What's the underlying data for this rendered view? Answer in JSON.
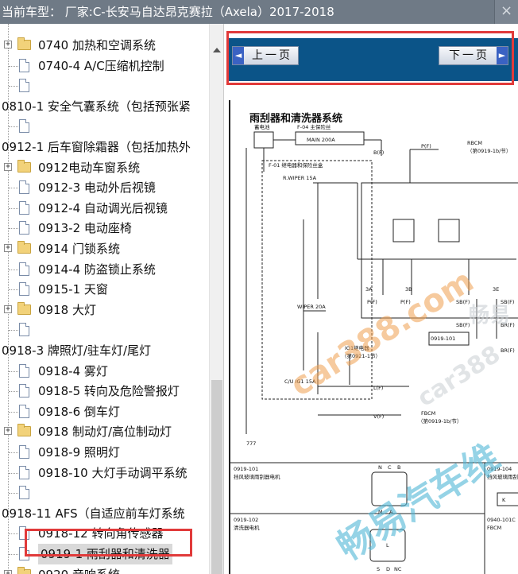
{
  "title_bar": {
    "text": "当前车型：  厂家:C-长安马自达昂克赛拉（Axela）2017-2018",
    "close_glyph": "×"
  },
  "tree": {
    "items": [
      {
        "label": "0740 加热和空调系统",
        "icon": "folder",
        "expandable": true
      },
      {
        "label": "0740-4 A/C压缩机控制",
        "icon": "page",
        "expandable": false
      },
      {
        "label": "",
        "icon": "page",
        "expandable": false
      },
      {
        "label": "0810-1 安全气囊系统（包括预张紧",
        "icon": "none",
        "expandable": false
      },
      {
        "label": "",
        "icon": "page",
        "expandable": false
      },
      {
        "label": "0912-1 后车窗除霜器（包括加热外",
        "icon": "none",
        "expandable": false
      },
      {
        "label": "0912电动车窗系统",
        "icon": "folder",
        "expandable": true
      },
      {
        "label": "0912-3 电动外后视镜",
        "icon": "page",
        "expandable": false
      },
      {
        "label": "0912-4 自动调光后视镜",
        "icon": "page",
        "expandable": false
      },
      {
        "label": "0913-2 电动座椅",
        "icon": "page",
        "expandable": false
      },
      {
        "label": "0914 门锁系统",
        "icon": "folder",
        "expandable": true
      },
      {
        "label": "0914-4 防盗锁止系统",
        "icon": "page",
        "expandable": false
      },
      {
        "label": "0915-1 天窗",
        "icon": "page",
        "expandable": false
      },
      {
        "label": "0918 大灯",
        "icon": "folder",
        "expandable": true
      },
      {
        "label": "",
        "icon": "page",
        "expandable": false
      },
      {
        "label": "0918-3 牌照灯/驻车灯/尾灯",
        "icon": "none",
        "expandable": false
      },
      {
        "label": "0918-4 雾灯",
        "icon": "page",
        "expandable": false
      },
      {
        "label": "0918-5 转向及危险警报灯",
        "icon": "page",
        "expandable": false
      },
      {
        "label": "0918-6 倒车灯",
        "icon": "page",
        "expandable": false
      },
      {
        "label": "0918 制动灯/高位制动灯",
        "icon": "folder",
        "expandable": true
      },
      {
        "label": "0918-9 照明灯",
        "icon": "page",
        "expandable": false
      },
      {
        "label": "0918-10 大灯手动调平系统",
        "icon": "page",
        "expandable": false
      },
      {
        "label": "",
        "icon": "page",
        "expandable": false
      },
      {
        "label": "0918-11 AFS（自适应前车灯系统",
        "icon": "none",
        "expandable": false
      },
      {
        "label": "0918-12 转向角传感器",
        "icon": "page",
        "expandable": false
      },
      {
        "label": "0919-1 雨刮器和清洗器",
        "icon": "page",
        "expandable": false,
        "selected": true
      },
      {
        "label": "0920 音响系统",
        "icon": "folder",
        "expandable": true
      }
    ]
  },
  "viewer": {
    "prev_label": "上一页",
    "next_label": "下一页",
    "prev_arrow": "◄",
    "next_arrow": "►",
    "doc_title": "雨刮器和清洗器系统",
    "watermark_1": "car388.com",
    "watermark_2": "畅易汽车维",
    "watermark_3": "car388",
    "watermark_4": "畅易",
    "diagram": {
      "labels": {
        "battery": "蓄电池",
        "fuse_main_name": "F-04 主保险丝",
        "fuse_main": "MAIN 200A",
        "bf": "B(F)",
        "pf": "P(F)",
        "f01": "F-01 继电器和保险丝盒",
        "rwiper": "R.WIPER 15A",
        "rbcm": "RBCM",
        "rbcm_ref": "（第0919-1b/节）",
        "wiper": "WIPER 20A",
        "ig1_relay": "IG1继电器",
        "ig1_ref": "（第0921-1节）",
        "cu_ig1": "C/U IG1 15A",
        "lf": "L(F)",
        "vf": "V(F)",
        "fbcm": "FBCM",
        "fbcm_ref": "（第0919-1b/节）",
        "conn_0919101": "0919-101",
        "front_wiper_motor": "挡风玻璃雨刮器电机",
        "conn_0919102": "0919-102",
        "washer_motor": "清洗器电机",
        "conn_0919104": "0919-104",
        "front_wiper_switch": "挡风玻璃雨刮器",
        "conn_0940101c": "0940-101C",
        "fbcm2": "FBCM",
        "pin_3a": "3A",
        "pin_3b": "3B",
        "pin_3e": "3E",
        "sbf_1": "SB(F)",
        "sbf_2": "SB(F)",
        "brf_1": "BR(F)",
        "brf_2": "BR(F)",
        "pin_n": "N",
        "pin_c": "C",
        "pin_b": "B",
        "pin_m": "M",
        "pin_a": "A",
        "pin_k": "K",
        "pin_l": "L",
        "pin_s": "S",
        "pin_d": "D",
        "pin_nc": "NC",
        "ground": "777"
      }
    }
  },
  "colors": {
    "titlebar": "#6f7a86",
    "navbar": "#0b5488",
    "highlight_box": "#e13a3a",
    "watermark_cyan": "#4fb7d6",
    "watermark_orange": "#f0a050"
  }
}
